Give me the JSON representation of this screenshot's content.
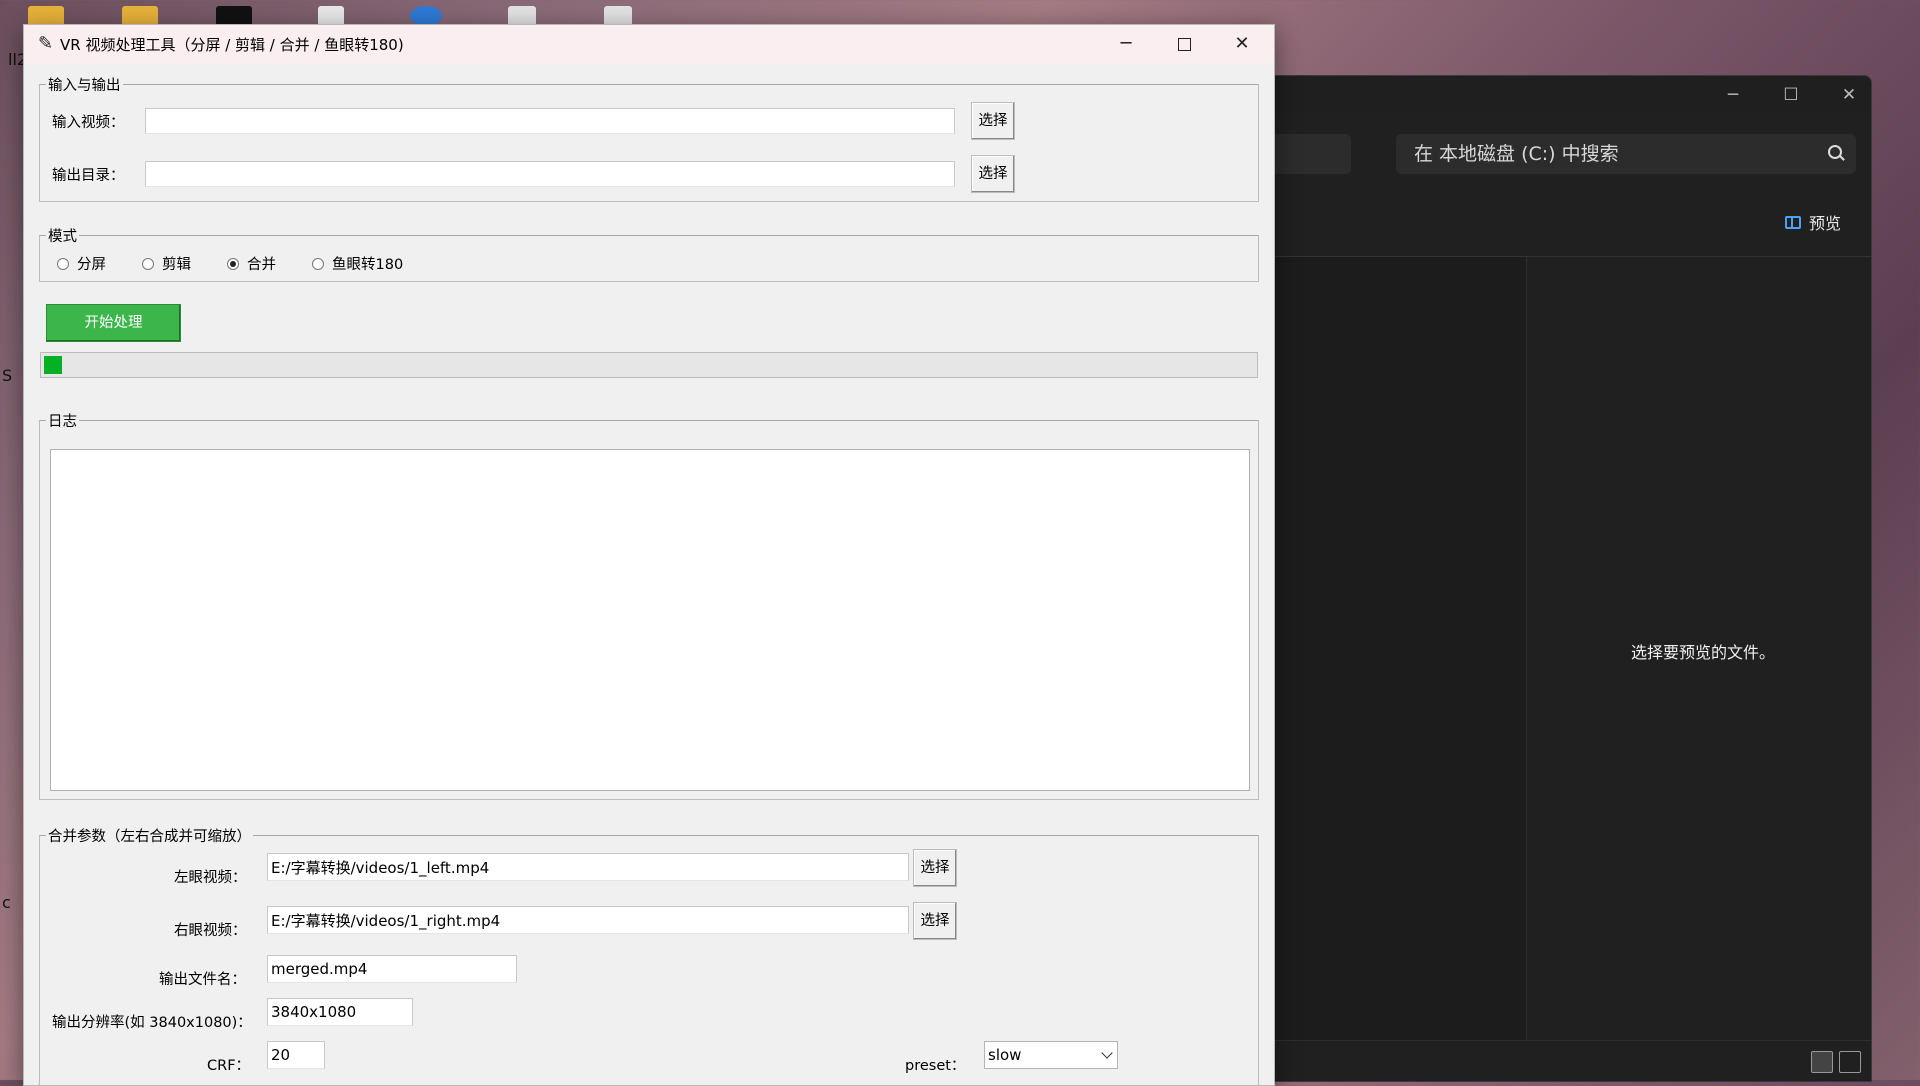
{
  "desktop": {
    "edge_text_1": "ll2",
    "edge_text_2": "S",
    "edge_text_3": "c"
  },
  "explorer": {
    "search_placeholder": "在 本地磁盘 (C:) 中搜索",
    "preview_button_label": "预览",
    "preview_message": "选择要预览的文件。"
  },
  "window": {
    "title": "VR 视频处理工具（分屏 / 剪辑 / 合并 / 鱼眼转180)",
    "minimize_glyph": "─",
    "close_glyph": "✕"
  },
  "io": {
    "legend": "输入与输出",
    "input_label": "输入视频：",
    "input_value": "",
    "input_browse": "选择",
    "output_label": "输出目录：",
    "output_value": "",
    "output_browse": "选择"
  },
  "mode": {
    "legend": "模式",
    "options": [
      "分屏",
      "剪辑",
      "合并",
      "鱼眼转180"
    ],
    "selected": "合并"
  },
  "start_button": "开始处理",
  "progress": {
    "value_fraction": 0.014
  },
  "log": {
    "legend": "日志",
    "content": ""
  },
  "merge": {
    "legend": "合并参数（左右合成并可缩放）",
    "left_label": "左眼视频：",
    "left_value": "E:/字幕转换/videos/1_left.mp4",
    "left_browse": "选择",
    "right_label": "右眼视频：",
    "right_value": "E:/字幕转换/videos/1_right.mp4",
    "right_browse": "选择",
    "filename_label": "输出文件名：",
    "filename_value": "merged.mp4",
    "resolution_label": "输出分辨率(如 3840x1080)：",
    "resolution_value": "3840x1080",
    "crf_label": "CRF：",
    "crf_value": "20",
    "preset_label": "preset：",
    "preset_value": "slow"
  }
}
